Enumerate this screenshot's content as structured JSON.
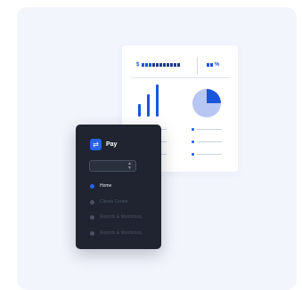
{
  "dashboard": {
    "stat_currency": "$",
    "stat_percent_symbol": "%",
    "accent_color": "#1a56db",
    "bars_relative_height": [
      0.4,
      0.7,
      1.0
    ],
    "pie_share": 0.25
  },
  "sidebar": {
    "brand_name": "Pay",
    "brand_icon": "swap-arrows-icon",
    "select_value": "",
    "items": [
      {
        "label": "Home",
        "active": true
      },
      {
        "label": "Clients Center",
        "active": false
      },
      {
        "label": "Reports & Monitoring",
        "active": false
      },
      {
        "label": "Reports & Monitoring",
        "active": false
      }
    ]
  }
}
